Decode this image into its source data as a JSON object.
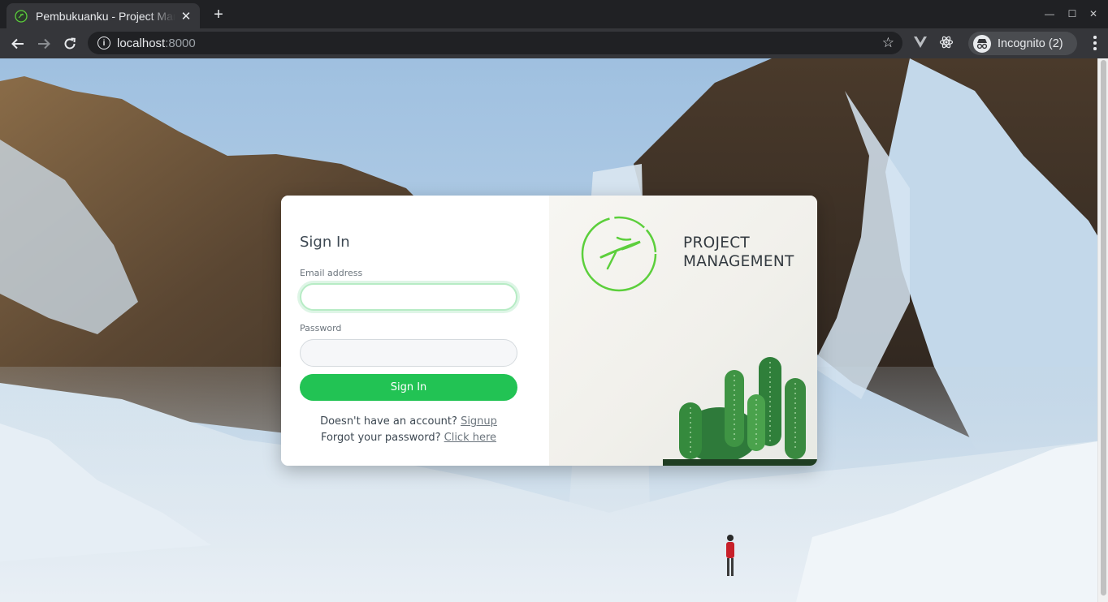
{
  "browser": {
    "tab_title": "Pembukuanku - Project Management",
    "tab_close": "✕",
    "new_tab": "+",
    "window_minimize": "—",
    "window_maximize": "☐",
    "window_close": "✕",
    "url_host": "localhost",
    "url_port": ":8000",
    "info": "i",
    "bookmark_star": "☆",
    "incognito_label": "Incognito (2)"
  },
  "login": {
    "title": "Sign In",
    "email_label": "Email address",
    "email_value": "",
    "password_label": "Password",
    "password_value": "",
    "submit_label": "Sign In",
    "signup_prompt": "Doesn't have an account?",
    "signup_link": "Signup",
    "forgot_prompt": "Forgot your password?",
    "forgot_link": "Click here"
  },
  "brand": {
    "line1": "PROJECT",
    "line2": "MANAGEMENT",
    "accent_color": "#5ccf3c"
  },
  "colors": {
    "primary_button": "#22c354",
    "chrome_dark": "#202124",
    "chrome_toolbar": "#35363a"
  }
}
